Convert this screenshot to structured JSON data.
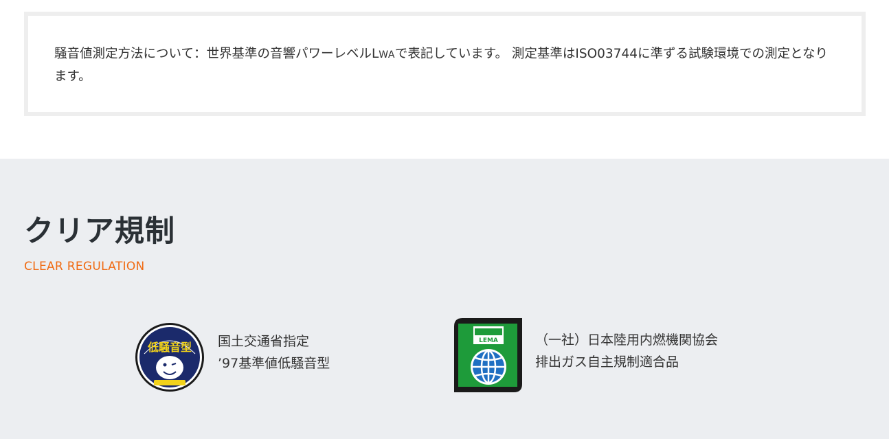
{
  "note": {
    "text_before": "騒音値測定方法について：世界基準の音響パワーレベルL",
    "subscript": "WA",
    "text_after": "で表記しています。 測定基準はISO03744に準ずる試験環境での測定となります。"
  },
  "section": {
    "title": "クリア規制",
    "subtitle": "CLEAR REGULATION"
  },
  "certifications": [
    {
      "icon": "low-noise-seal-icon",
      "badge_text": "低騒音型",
      "line1": "国土交通省指定",
      "line2": "’97基準値低騒音型"
    },
    {
      "icon": "lema-globe-icon",
      "badge_text": "LEMA",
      "line1": "（一社）日本陸用内燃機関協会",
      "line2": "排出ガス自主規制適合品"
    }
  ],
  "colors": {
    "section_bg": "#eceef1",
    "accent_orange": "#f06a12",
    "title_dark": "#2a3035",
    "seal_navy": "#1b2a6b",
    "seal_yellow": "#f2d21a",
    "lema_green": "#1e9b3a",
    "lema_blue": "#1f6fc2"
  }
}
